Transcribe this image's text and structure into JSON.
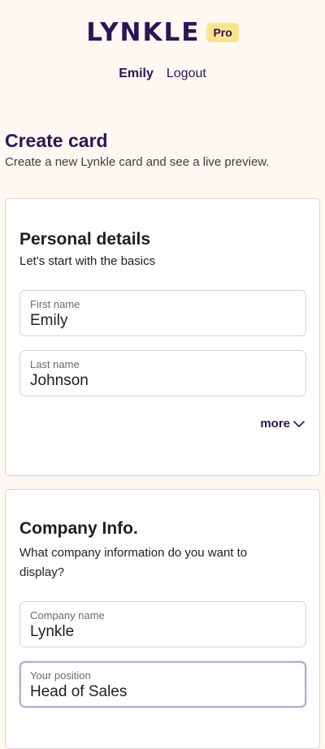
{
  "header": {
    "logo": "LYNKLE",
    "badge": "Pro",
    "user_name": "Emily",
    "logout_label": "Logout"
  },
  "page": {
    "title": "Create card",
    "subtitle": "Create a new Lynkle card and see a live preview."
  },
  "personal": {
    "title": "Personal details",
    "description": "Let's start with the basics",
    "fields": [
      {
        "label": "First name",
        "value": "Emily"
      },
      {
        "label": "Last name",
        "value": "Johnson"
      }
    ],
    "more_label": "more"
  },
  "company": {
    "title": "Company Info.",
    "description": "What company information do you want to display?",
    "fields": [
      {
        "label": "Company name",
        "value": "Lynkle"
      },
      {
        "label": "Your position",
        "value": "Head of Sales"
      }
    ]
  },
  "icons": {
    "more_toggle": "chevron-down-icon"
  },
  "colors": {
    "brand": "#2d1456",
    "badge": "#fbe38b",
    "background": "#fdf9f2",
    "focus_border": "#b8aed0"
  }
}
